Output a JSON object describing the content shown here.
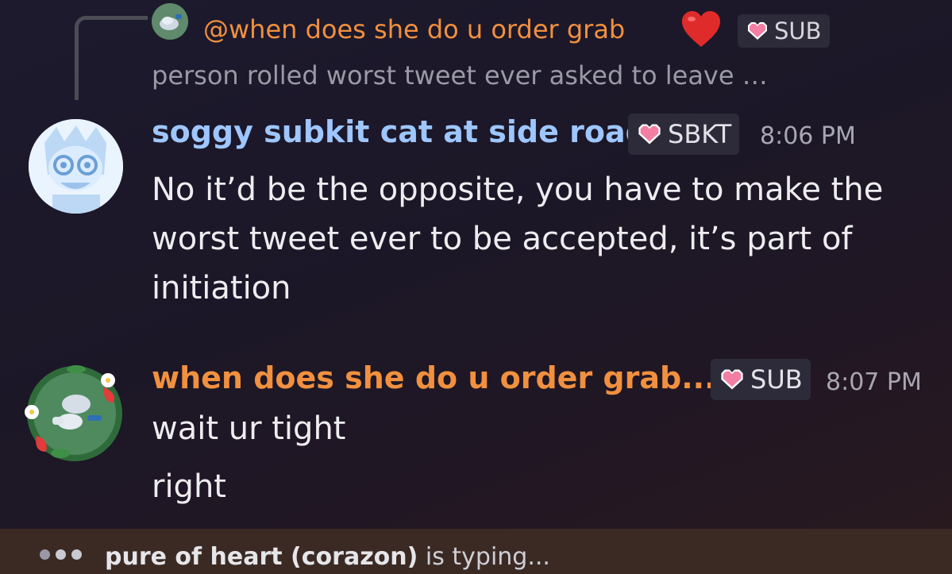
{
  "reply": {
    "name": "@when does she do u order grab",
    "heart_emoji": "heart-emoji",
    "badge_label": "SUB",
    "preview": "person rolled worst tweet ever asked to leave …"
  },
  "messages": [
    {
      "author": "soggy subkit cat at side road",
      "badge": "SBKT",
      "time": "8:06 PM",
      "name_color": "#9ec6ff",
      "text": "No it’d be the opposite, you have to make the worst tweet ever to be accepted, it’s part of initiation"
    },
    {
      "author": "when does she do u order grab...",
      "badge": "SUB",
      "time": "8:07 PM",
      "name_color": "#f1903f",
      "lines": [
        "wait ur tight",
        "right"
      ]
    }
  ],
  "typing": {
    "user": "pure of heart (corazon)",
    "suffix": " is typing..."
  },
  "colors": {
    "accent_orange": "#f1903f",
    "accent_blue": "#9ec6ff",
    "badge_bg": "#2d2b3a",
    "typing_bar": "#3b2a24"
  }
}
